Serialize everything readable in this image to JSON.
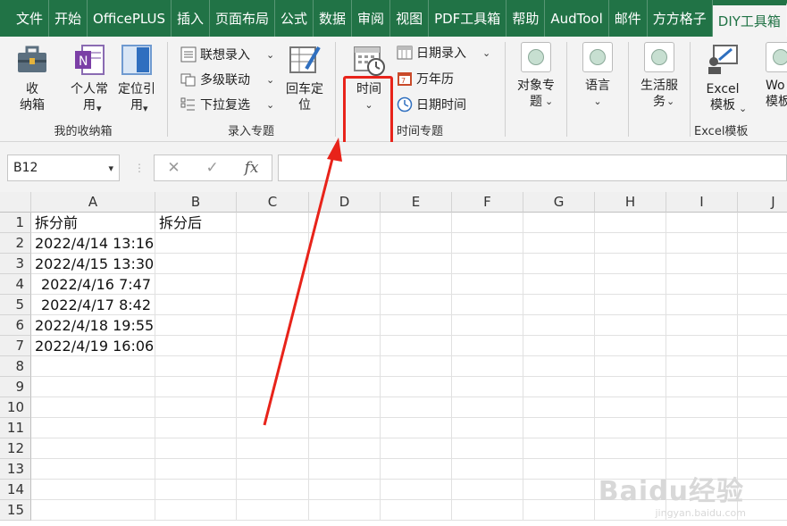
{
  "tabs": [
    "文件",
    "开始",
    "OfficePLUS",
    "插入",
    "页面布局",
    "公式",
    "数据",
    "审阅",
    "视图",
    "PDF工具箱",
    "帮助",
    "AudTool",
    "邮件",
    "方方格子",
    "DIY工具箱"
  ],
  "active_tab": "DIY工具箱",
  "ribbon": {
    "group_storage": {
      "label": "我的收纳箱",
      "btn_storage": "收\n纳箱",
      "btn_personal": "个人常\n用",
      "btn_locate": "定位引\n用"
    },
    "group_input": {
      "label": "录入专题",
      "btn_assoc": "联想录入",
      "btn_multi": "多级联动",
      "btn_dropdown": "下拉复选",
      "btn_enter": "回车定\n位"
    },
    "group_time": {
      "label": "时间专题",
      "btn_time": "时间",
      "btn_date_input": "日期录入",
      "btn_calendar": "万年历",
      "btn_datetime": "日期时间"
    },
    "btn_object": "对象专\n题",
    "btn_language": "语言",
    "btn_life": "生活服\n务",
    "group_excel": {
      "label": "Excel模板",
      "btn_template": "Excel\n模板",
      "btn_word": "Wo\n模板"
    }
  },
  "formula_bar": {
    "name_box": "B12",
    "cancel": "✕",
    "confirm": "✓",
    "fx": "fx",
    "value": ""
  },
  "columns": [
    "A",
    "B",
    "C",
    "D",
    "E",
    "F",
    "G",
    "H",
    "I",
    "J"
  ],
  "rows": [
    "1",
    "2",
    "3",
    "4",
    "5",
    "6",
    "7",
    "8",
    "9",
    "10",
    "11",
    "12",
    "13",
    "14",
    "15"
  ],
  "cells": {
    "A1": "拆分前",
    "B1": "拆分后",
    "A2": "2022/4/14 13:16",
    "A3": "2022/4/15 13:30",
    "A4": "2022/4/16 7:47",
    "A5": "2022/4/17 8:42",
    "A6": "2022/4/18 19:55",
    "A7": "2022/4/19 16:06"
  },
  "watermark": "Baidu经验",
  "watermark_sub": "jingyan.baidu.com",
  "colors": {
    "excel_green": "#217346",
    "highlight_red": "#e8231a"
  }
}
